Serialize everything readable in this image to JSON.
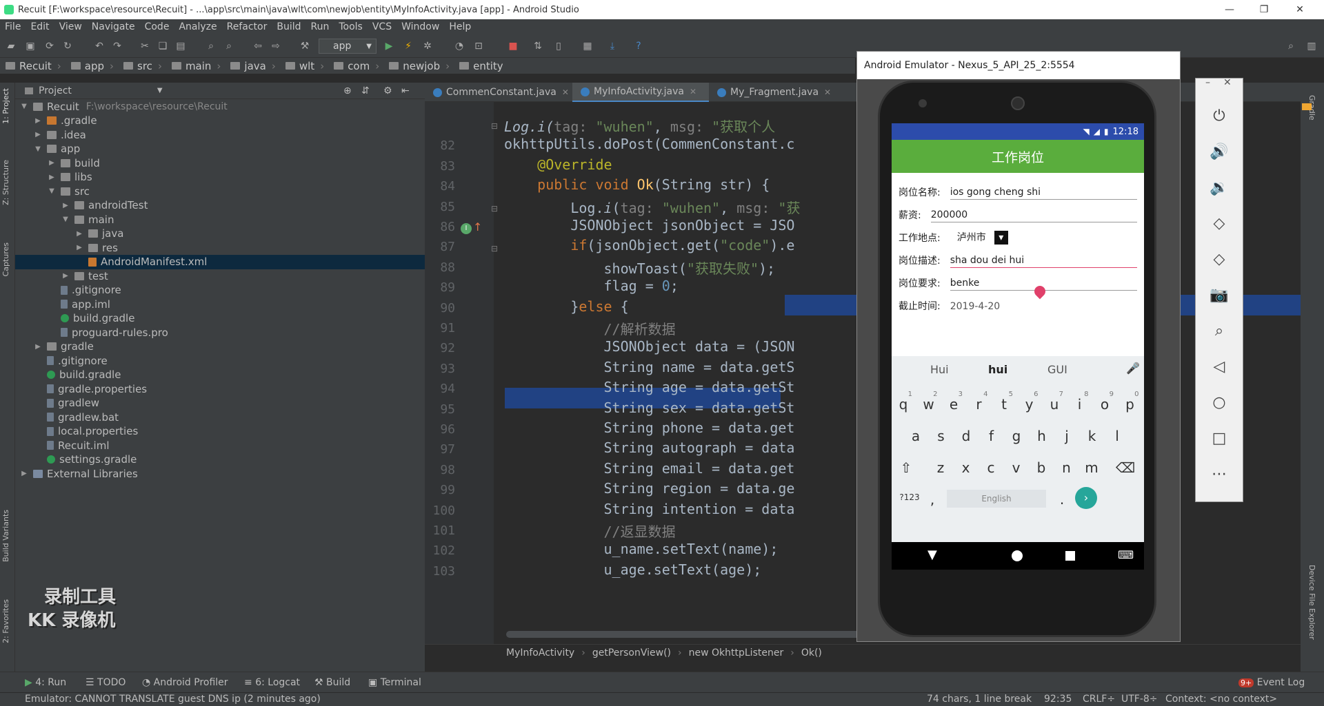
{
  "window": {
    "title": "Recuit [F:\\workspace\\resource\\Recuit] - ...\\app\\src\\main\\java\\wlt\\com\\newjob\\entity\\MyInfoActivity.java [app] - Android Studio",
    "controls": [
      "—",
      "❐",
      "✕"
    ]
  },
  "menu": [
    "File",
    "Edit",
    "View",
    "Navigate",
    "Code",
    "Analyze",
    "Refactor",
    "Build",
    "Run",
    "Tools",
    "VCS",
    "Window",
    "Help"
  ],
  "toolbar": {
    "run_config": "app"
  },
  "breadcrumbs": [
    "Recuit",
    "app",
    "src",
    "main",
    "java",
    "wlt",
    "com",
    "newjob",
    "entity"
  ],
  "project_panel": {
    "header": "Project",
    "tree": [
      {
        "label": "Recuit",
        "path": "F:\\workspace\\resource\\Recuit",
        "depth": 0,
        "arrow": "▼",
        "icon": "folder"
      },
      {
        "label": ".gradle",
        "depth": 1,
        "arrow": "▶",
        "icon": "ofolder"
      },
      {
        "label": ".idea",
        "depth": 1,
        "arrow": "▶",
        "icon": "folder"
      },
      {
        "label": "app",
        "depth": 1,
        "arrow": "▼",
        "icon": "folder"
      },
      {
        "label": "build",
        "depth": 2,
        "arrow": "▶",
        "icon": "folder"
      },
      {
        "label": "libs",
        "depth": 2,
        "arrow": "▶",
        "icon": "folder"
      },
      {
        "label": "src",
        "depth": 2,
        "arrow": "▼",
        "icon": "folder"
      },
      {
        "label": "androidTest",
        "depth": 3,
        "arrow": "▶",
        "icon": "folder"
      },
      {
        "label": "main",
        "depth": 3,
        "arrow": "▼",
        "icon": "folder"
      },
      {
        "label": "java",
        "depth": 4,
        "arrow": "▶",
        "icon": "folder"
      },
      {
        "label": "res",
        "depth": 4,
        "arrow": "▶",
        "icon": "folder"
      },
      {
        "label": "AndroidManifest.xml",
        "depth": 4,
        "arrow": "",
        "icon": "xml",
        "selected": true
      },
      {
        "label": "test",
        "depth": 3,
        "arrow": "▶",
        "icon": "folder"
      },
      {
        "label": ".gitignore",
        "depth": 2,
        "arrow": "",
        "icon": "file"
      },
      {
        "label": "app.iml",
        "depth": 2,
        "arrow": "",
        "icon": "file"
      },
      {
        "label": "build.gradle",
        "depth": 2,
        "arrow": "",
        "icon": "gradle"
      },
      {
        "label": "proguard-rules.pro",
        "depth": 2,
        "arrow": "",
        "icon": "file"
      },
      {
        "label": "gradle",
        "depth": 1,
        "arrow": "▶",
        "icon": "folder"
      },
      {
        "label": ".gitignore",
        "depth": 1,
        "arrow": "",
        "icon": "file"
      },
      {
        "label": "build.gradle",
        "depth": 1,
        "arrow": "",
        "icon": "gradle"
      },
      {
        "label": "gradle.properties",
        "depth": 1,
        "arrow": "",
        "icon": "file"
      },
      {
        "label": "gradlew",
        "depth": 1,
        "arrow": "",
        "icon": "file"
      },
      {
        "label": "gradlew.bat",
        "depth": 1,
        "arrow": "",
        "icon": "file"
      },
      {
        "label": "local.properties",
        "depth": 1,
        "arrow": "",
        "icon": "file"
      },
      {
        "label": "Recuit.iml",
        "depth": 1,
        "arrow": "",
        "icon": "file"
      },
      {
        "label": "settings.gradle",
        "depth": 1,
        "arrow": "",
        "icon": "gradle"
      },
      {
        "label": "External Libraries",
        "depth": 0,
        "arrow": "▶",
        "icon": "lib"
      }
    ]
  },
  "left_strip_tabs": [
    "1: Project",
    "Z: Structure",
    "Captures",
    "Build Variants",
    "2: Favorites"
  ],
  "right_strip_tabs": [
    "Gradle",
    "Device File Explorer"
  ],
  "editor": {
    "tabs": [
      "CommenConstant.java",
      "MyInfoActivity.java",
      "My_Fragment.java"
    ],
    "active_tab": 1,
    "lines": [
      {
        "n": "",
        "html": "<span class='it'>Log.i(</span><span class='cm'>tag: </span><span class='str'>\"wuhen\"</span>, <span class='cm'>msg: </span><span class='str'>\"获取个人</span>"
      },
      {
        "n": "82",
        "html": "okhttpUtils.doPost(CommenConstant.c"
      },
      {
        "n": "83",
        "html": "    <span class='an'>@Override</span>"
      },
      {
        "n": "84",
        "html": "    <span class='kw'>public void </span><span class='fn'>Ok</span>(String str) {"
      },
      {
        "n": "85",
        "html": "        Log.<span class='it'>i</span>(<span class='cm'>tag: </span><span class='str'>\"wuhen\"</span>, <span class='cm'>msg: </span><span class='str'>\"获</span>"
      },
      {
        "n": "86",
        "html": "        JSONObject jsonObject = JSO"
      },
      {
        "n": "87",
        "html": "        <span class='kw'>if</span>(jsonObject.get(<span class='str'>\"code\"</span>).e"
      },
      {
        "n": "88",
        "html": "            showToast(<span class='str'>\"获取失败\"</span>);"
      },
      {
        "n": "89",
        "html": "            flag = <span class='num'>0</span>;"
      },
      {
        "n": "90",
        "html": "        }<span class='kw'>else </span>{"
      },
      {
        "n": "91",
        "html": "            <span class='cm'>//解析数据</span>"
      },
      {
        "n": "92",
        "html": "            JSONObject data = (JSON"
      },
      {
        "n": "93",
        "html": "            String name = data.getS"
      },
      {
        "n": "94",
        "html": "            String age = data.getSt"
      },
      {
        "n": "95",
        "html": "            String sex = data.getSt"
      },
      {
        "n": "96",
        "html": "            String phone = data.get"
      },
      {
        "n": "97",
        "html": "            String autograph = data"
      },
      {
        "n": "98",
        "html": "            String email = data.get"
      },
      {
        "n": "99",
        "html": "            String region = data.ge"
      },
      {
        "n": "100",
        "html": "            String intention = data"
      },
      {
        "n": "101",
        "html": "            <span class='cm'>//返显数据</span>"
      },
      {
        "n": "102",
        "html": "            u_name.setText(name);"
      },
      {
        "n": "103",
        "html": "            u_age.setText(age);"
      }
    ],
    "breadcrumbs": [
      "MyInfoActivity",
      "getPersonView()",
      "new OkhttpListener",
      "Ok()"
    ]
  },
  "bottom_tools": [
    "4: Run",
    "TODO",
    "Android Profiler",
    "6: Logcat",
    "Build",
    "Terminal",
    "Event Log"
  ],
  "event_badge": "9+",
  "status": {
    "message": "Emulator: CANNOT TRANSLATE guest DNS ip (2 minutes ago)",
    "chars": "74 chars, 1 line break",
    "position": "92:35",
    "line_sep": "CRLF÷",
    "encoding": "UTF-8÷",
    "context": "Context: <no context>"
  },
  "emulator": {
    "title": "Android Emulator - Nexus_5_API_25_2:5554",
    "time": "12:18",
    "app_title": "工作岗位",
    "fields": [
      {
        "label": "岗位名称:",
        "value": "ios gong cheng shi",
        "red": false
      },
      {
        "label": "薪资:",
        "value": "200000",
        "red": false
      },
      {
        "label": "工作地点:",
        "value": "泸州市",
        "red": false
      },
      {
        "label": "岗位描述:",
        "value": "sha dou dei hui",
        "red": true
      },
      {
        "label": "岗位要求:",
        "value": "benke",
        "red": false
      },
      {
        "label": "截止时间:",
        "value": "2019-4-20",
        "red": false
      }
    ],
    "suggestions": [
      "Hui",
      "hui",
      "GUI"
    ],
    "keyboard": {
      "row1": [
        "q",
        "w",
        "e",
        "r",
        "t",
        "y",
        "u",
        "i",
        "o",
        "p"
      ],
      "row1_digits": [
        "1",
        "2",
        "3",
        "4",
        "5",
        "6",
        "7",
        "8",
        "9",
        "0"
      ],
      "row2": [
        "a",
        "s",
        "d",
        "f",
        "g",
        "h",
        "j",
        "k",
        "l"
      ],
      "row3": [
        "z",
        "x",
        "c",
        "v",
        "b",
        "n",
        "m"
      ],
      "symbols": "?123",
      "space": "English"
    }
  },
  "watermark": [
    "录制工具",
    "KK 录像机"
  ]
}
